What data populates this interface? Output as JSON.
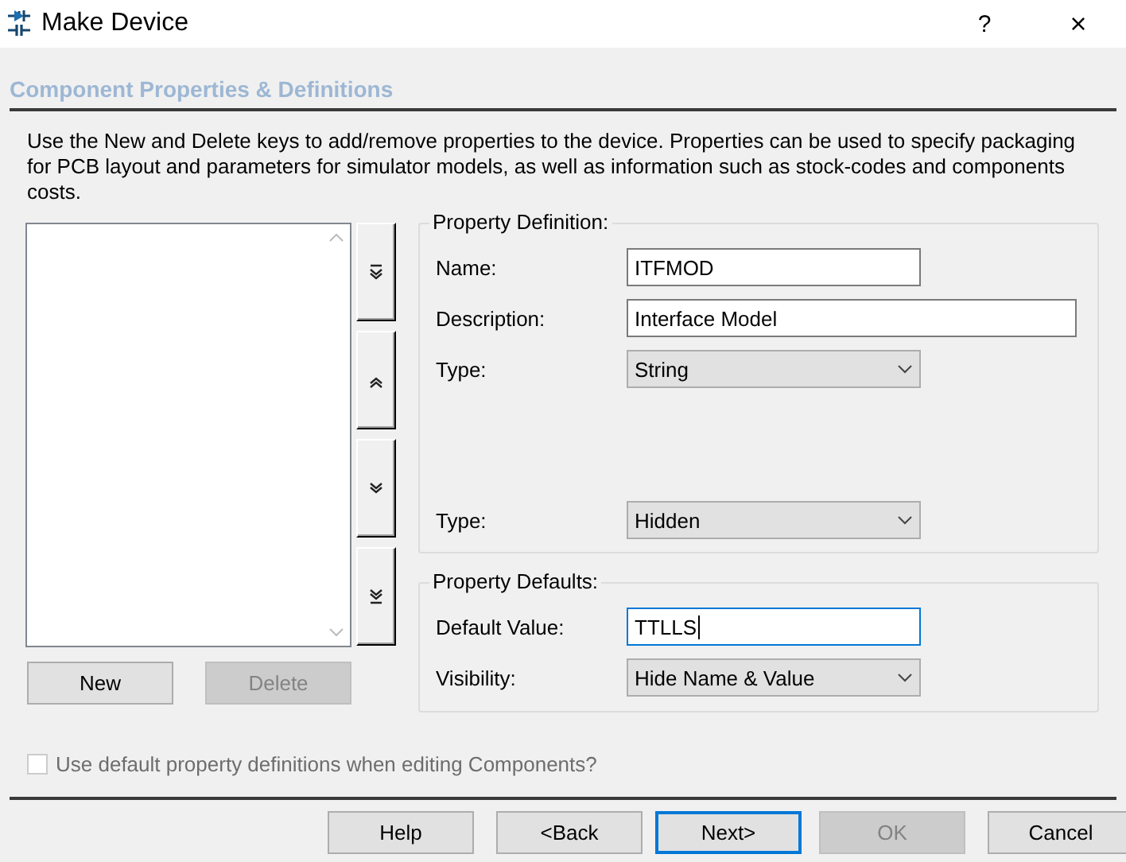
{
  "window": {
    "title": "Make Device",
    "help_button": "?",
    "close_button": "×"
  },
  "header": "Component Properties & Definitions",
  "description": "Use the New and Delete keys to add/remove properties to the device. Properties can be used to specify packaging for PCB layout and parameters for simulator models, as well as information such as stock-codes and components costs.",
  "list_buttons": [
    {
      "label": "New",
      "disabled": false
    },
    {
      "label": "Delete",
      "disabled": true
    }
  ],
  "property_definition": {
    "title": "Property Definition:",
    "fields": [
      {
        "kind": "text",
        "label": "Name:",
        "value": "ITFMOD",
        "focused": false
      },
      {
        "kind": "wide-text",
        "label": "Description:",
        "value": "Interface Model",
        "focused": false
      },
      {
        "kind": "select",
        "label": "Type:",
        "value": "String",
        "focused": false
      },
      {
        "kind": "select",
        "label": "Type:",
        "value": "Hidden",
        "focused": false
      }
    ]
  },
  "property_defaults": {
    "title": "Property Defaults:",
    "fields": [
      {
        "kind": "text",
        "label": "Default Value:",
        "value": "TTLLS",
        "focused": true
      },
      {
        "kind": "select",
        "label": "Visibility:",
        "value": "Hide Name & Value",
        "focused": false
      }
    ]
  },
  "use_defaults": {
    "label": "Use default property definitions when editing Components?",
    "checked": false,
    "disabled": true
  },
  "buttons": [
    {
      "label": "Help",
      "disabled": false,
      "focused": false
    },
    {
      "label": "<Back",
      "disabled": false,
      "focused": false
    },
    {
      "label": "Next>",
      "disabled": false,
      "focused": true
    },
    {
      "label": "OK",
      "disabled": true,
      "focused": false
    },
    {
      "label": "Cancel",
      "disabled": false,
      "focused": false
    }
  ]
}
